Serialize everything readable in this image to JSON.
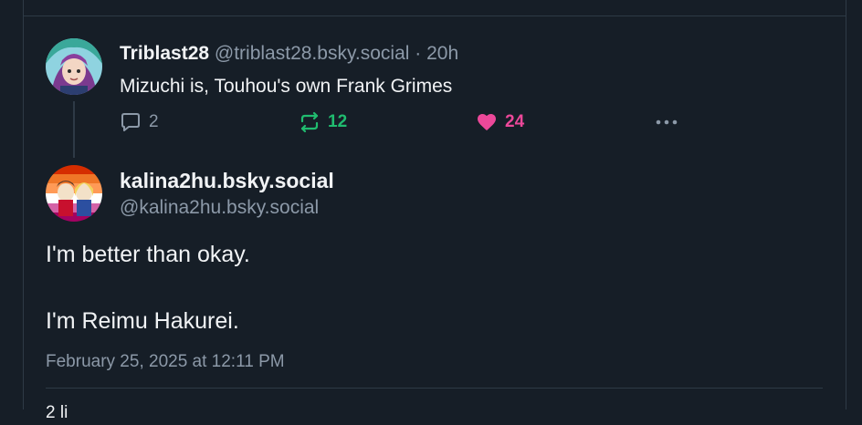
{
  "parent_post": {
    "display_name": "Triblast28",
    "handle": "@triblast28.bsky.social",
    "separator": "·",
    "time": "20h",
    "text": "Mizuchi is, Touhou's own Frank Grimes",
    "replies": "2",
    "reposts": "12",
    "likes": "24",
    "icons": {
      "reply": "reply-icon",
      "repost": "repost-icon",
      "like": "heart-icon",
      "more": "more-dots-icon"
    }
  },
  "main_post": {
    "display_name": "kalina2hu.bsky.social",
    "handle": "@kalina2hu.bsky.social",
    "text_line_1": "I'm better than okay.",
    "text_line_2": "I'm Reimu Hakurei.",
    "timestamp": "February 25, 2025 at 12:11 PM",
    "next_section_partial": "2 li"
  },
  "colors": {
    "background": "#161e27",
    "border": "#2e3a46",
    "text_primary": "#f1f3f5",
    "text_secondary": "#8c99a8",
    "repost_green": "#20bc6f",
    "like_pink": "#ec4899"
  }
}
